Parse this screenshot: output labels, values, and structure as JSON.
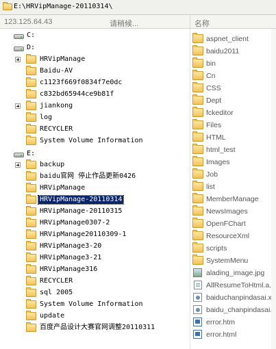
{
  "path_bar": {
    "path": "E:\\HRVipManage-20110314\\",
    "icon": "folder-icon"
  },
  "header": {
    "ip": "123.125.64.43",
    "status": "请稍候...",
    "name_column": "名称"
  },
  "tree": [
    {
      "label": "C:",
      "type": "drive",
      "level": 0,
      "expander": false
    },
    {
      "label": "D:",
      "type": "drive",
      "level": 0,
      "expander": false
    },
    {
      "label": "HRVipManage",
      "type": "folder",
      "level": 1,
      "expander": true
    },
    {
      "label": "Baidu-AV",
      "type": "folder",
      "level": 1,
      "expander": false
    },
    {
      "label": "c1123f669f0834f7e0dc",
      "type": "folder",
      "level": 1,
      "expander": false
    },
    {
      "label": "c832bd65944ce9b81f",
      "type": "folder",
      "level": 1,
      "expander": false
    },
    {
      "label": "jiankong",
      "type": "folder",
      "level": 1,
      "expander": true
    },
    {
      "label": "log",
      "type": "folder",
      "level": 1,
      "expander": false
    },
    {
      "label": "RECYCLER",
      "type": "folder",
      "level": 1,
      "expander": false
    },
    {
      "label": "System Volume Information",
      "type": "folder",
      "level": 1,
      "expander": false
    },
    {
      "label": "E:",
      "type": "drive",
      "level": 0,
      "expander": false
    },
    {
      "label": "backup",
      "type": "folder",
      "level": 1,
      "expander": true
    },
    {
      "label": "baidu官网 停止作品更新0426",
      "type": "folder",
      "level": 1,
      "expander": false
    },
    {
      "label": "HRVipManage",
      "type": "folder",
      "level": 1,
      "expander": false
    },
    {
      "label": "HRVipManage-20110314",
      "type": "folder",
      "level": 1,
      "expander": false,
      "selected": true
    },
    {
      "label": "HRVipManage-20110315",
      "type": "folder",
      "level": 1,
      "expander": false
    },
    {
      "label": "HRVipManage0307-2",
      "type": "folder",
      "level": 1,
      "expander": false
    },
    {
      "label": "HRVipManage20110309-1",
      "type": "folder",
      "level": 1,
      "expander": false
    },
    {
      "label": "HRVipManage3-20",
      "type": "folder",
      "level": 1,
      "expander": false
    },
    {
      "label": "HRVipManage3-21",
      "type": "folder",
      "level": 1,
      "expander": false
    },
    {
      "label": "HRVipManage316",
      "type": "folder",
      "level": 1,
      "expander": false
    },
    {
      "label": "RECYCLER",
      "type": "folder",
      "level": 1,
      "expander": false
    },
    {
      "label": "sql 2005",
      "type": "folder",
      "level": 1,
      "expander": false
    },
    {
      "label": "System Volume Information",
      "type": "folder",
      "level": 1,
      "expander": false
    },
    {
      "label": "update",
      "type": "folder",
      "level": 1,
      "expander": false
    },
    {
      "label": "百度产品设计大赛官网调整20110311",
      "type": "folder",
      "level": 1,
      "expander": false
    }
  ],
  "files": [
    {
      "label": "aspnet_client",
      "icon": "folder"
    },
    {
      "label": "baidu2011",
      "icon": "folder"
    },
    {
      "label": "bin",
      "icon": "folder"
    },
    {
      "label": "Cn",
      "icon": "folder"
    },
    {
      "label": "CSS",
      "icon": "folder"
    },
    {
      "label": "Dept",
      "icon": "folder"
    },
    {
      "label": "fckeditor",
      "icon": "folder"
    },
    {
      "label": "Files",
      "icon": "folder"
    },
    {
      "label": "HTML",
      "icon": "folder"
    },
    {
      "label": "html_test",
      "icon": "folder"
    },
    {
      "label": "Images",
      "icon": "folder"
    },
    {
      "label": "Job",
      "icon": "folder"
    },
    {
      "label": "list",
      "icon": "folder"
    },
    {
      "label": "MemberManage",
      "icon": "folder"
    },
    {
      "label": "NewsImages",
      "icon": "folder"
    },
    {
      "label": "OpenFChart",
      "icon": "folder"
    },
    {
      "label": "ResourceXml",
      "icon": "folder"
    },
    {
      "label": "scripts",
      "icon": "folder"
    },
    {
      "label": "SystemMenu",
      "icon": "folder"
    },
    {
      "label": "alading_image.jpg",
      "icon": "image"
    },
    {
      "label": "AllResumeToHtml.a...",
      "icon": "file"
    },
    {
      "label": "baiduchanpindasai.x...",
      "icon": "gear"
    },
    {
      "label": "baidu_chanpindasai...",
      "icon": "gear"
    },
    {
      "label": "error.htm",
      "icon": "html"
    },
    {
      "label": "error.html",
      "icon": "html"
    }
  ]
}
